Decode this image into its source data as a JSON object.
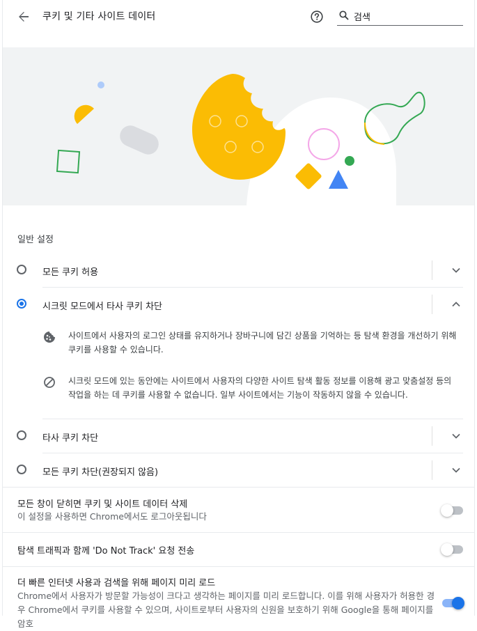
{
  "header": {
    "title": "쿠키 및 기타 사이트 데이터",
    "search_value": "검색",
    "back_icon": "arrow-left-icon",
    "help_icon": "help-circle-icon",
    "search_icon": "search-icon"
  },
  "colors": {
    "accent": "#1a73e8",
    "cookie_yellow": "#fbbc04",
    "green": "#34a853",
    "pink": "#f4a7e8",
    "banner_bg": "#f1f3f4"
  },
  "general": {
    "section_title": "일반 설정",
    "options": [
      {
        "label": "모든 쿠키 허용",
        "selected": false,
        "expanded": false
      },
      {
        "label": "시크릿 모드에서 타사 쿠키 차단",
        "selected": true,
        "expanded": true
      },
      {
        "label": "타사 쿠키 차단",
        "selected": false,
        "expanded": false
      },
      {
        "label": "모든 쿠키 차단(권장되지 않음)",
        "selected": false,
        "expanded": false
      }
    ],
    "details": [
      {
        "icon": "cookie-icon",
        "text": "사이트에서 사용자의 로그인 상태를 유지하거나 장바구니에 담긴 상품을 기억하는 등 탐색 환경을 개선하기 위해 쿠키를 사용할 수 있습니다."
      },
      {
        "icon": "block-icon",
        "text": "시크릿 모드에 있는 동안에는 사이트에서 사용자의 다양한 사이트 탐색 활동 정보를 이용해 광고 맞춤설정 등의 작업을 하는 데 쿠키를 사용할 수 없습니다. 일부 사이트에서는 기능이 작동하지 않을 수 있습니다."
      }
    ]
  },
  "toggles": [
    {
      "title": "모든 창이 닫히면 쿠키 및 사이트 데이터 삭제",
      "subtitle": "이 설정을 사용하면 Chrome에서도 로그아웃됩니다",
      "on": false
    },
    {
      "title": "탐색 트래픽과 함께 'Do Not Track' 요청 전송",
      "subtitle": "",
      "on": false
    },
    {
      "title": "더 빠른 인터넷 사용과 검색을 위해 페이지 미리 로드",
      "subtitle": "Chrome에서 사용자가 방문할 가능성이 크다고 생각하는 페이지를 미리 로드합니다. 이를 위해 사용자가 허용한 경우 Chrome에서 쿠키를 사용할 수 있으며, 사이트로부터 사용자의 신원을 보호하기 위해 Google을 통해 페이지를 암호",
      "on": true
    }
  ]
}
